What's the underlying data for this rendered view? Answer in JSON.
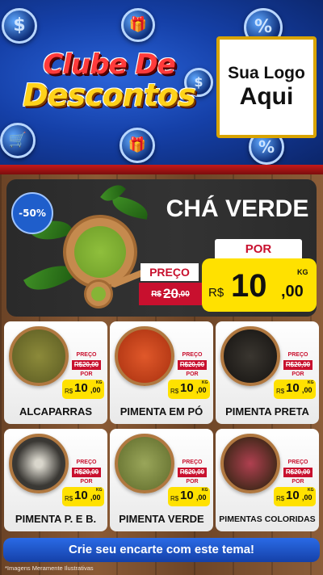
{
  "header": {
    "title_line1": "Clube De",
    "title_line2": "Descontos",
    "logo_line1": "Sua Logo",
    "logo_line2": "Aqui"
  },
  "featured": {
    "discount": "-50%",
    "name": "CHÁ VERDE",
    "old_label": "PREÇO",
    "old_currency": "R$",
    "old_int": "20",
    "old_cents": ",00",
    "new_label": "POR",
    "new_currency": "R$",
    "new_int": "10",
    "new_cents": ",00",
    "unit": "KG"
  },
  "products": [
    {
      "name": "ALCAPARRAS",
      "old_label": "PREÇO",
      "old_price": "R$20,00",
      "new_label": "POR",
      "currency": "R$",
      "int": "10",
      "cents": ",00",
      "unit": "KG",
      "color": "#7a7a2e"
    },
    {
      "name": "PIMENTA EM PÓ",
      "old_label": "PREÇO",
      "old_price": "R$20,00",
      "new_label": "POR",
      "currency": "R$",
      "int": "10",
      "cents": ",00",
      "unit": "KG",
      "color": "#c43a14"
    },
    {
      "name": "PIMENTA PRETA",
      "old_label": "PREÇO",
      "old_price": "R$20,00",
      "new_label": "POR",
      "currency": "R$",
      "int": "10",
      "cents": ",00",
      "unit": "KG",
      "color": "#2a2620"
    },
    {
      "name": "PIMENTA P. E B.",
      "old_label": "PREÇO",
      "old_price": "R$20,00",
      "new_label": "POR",
      "currency": "R$",
      "int": "10",
      "cents": ",00",
      "unit": "KG",
      "color": "#5a5650"
    },
    {
      "name": "PIMENTA VERDE",
      "old_label": "PREÇO",
      "old_price": "R$20,00",
      "new_label": "POR",
      "currency": "R$",
      "int": "10",
      "cents": ",00",
      "unit": "KG",
      "color": "#7c8a3e"
    },
    {
      "name": "PIMENTAS COLORIDAS",
      "old_label": "PREÇO",
      "old_price": "R$20,00",
      "new_label": "POR",
      "currency": "R$",
      "int": "10",
      "cents": ",00",
      "unit": "KG",
      "color": "#7a2a30"
    }
  ],
  "footer": {
    "cta": "Crie seu encarte com este tema!",
    "disclaimer": "*Imagens Meramente Ilustrativas"
  },
  "colors": {
    "header_blue": "#1540a8",
    "price_yellow": "#ffe100",
    "price_red": "#c8102e"
  },
  "icons": [
    "dollar-coin-icon",
    "gift-coin-icon",
    "percent-coin-icon",
    "cart-coin-icon"
  ]
}
